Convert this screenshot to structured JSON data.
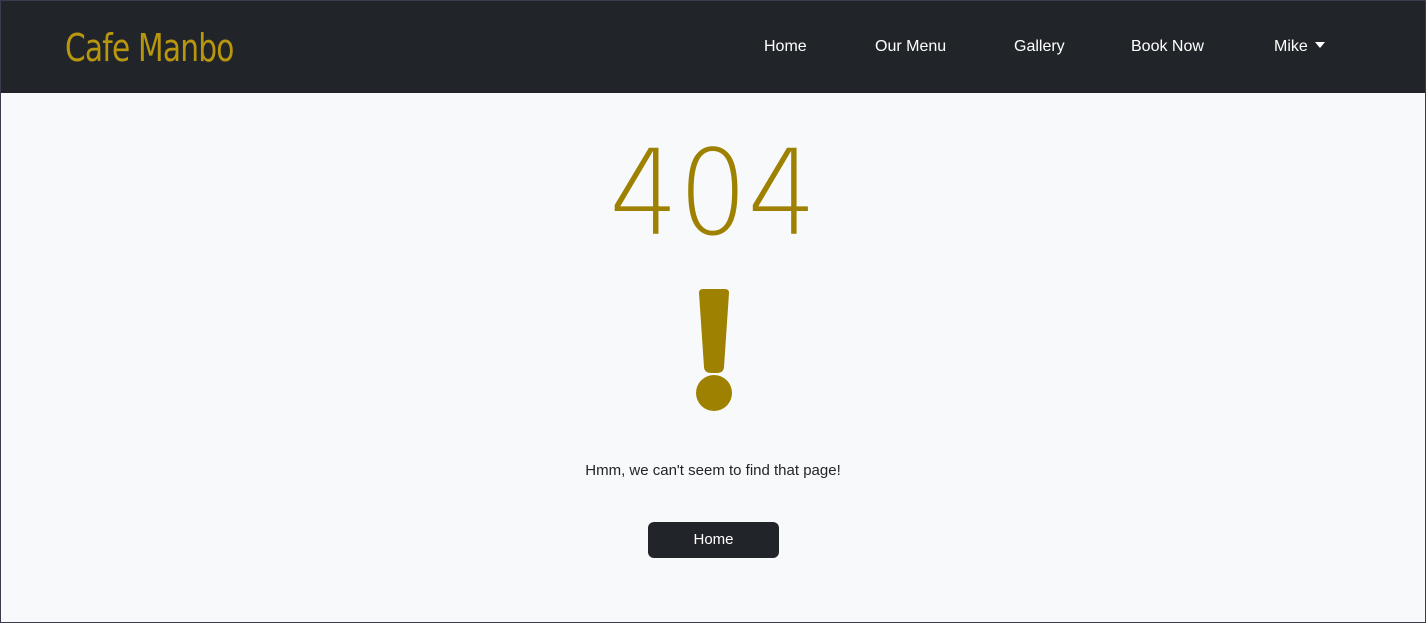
{
  "navbar": {
    "brand": "Cafe Manbo",
    "links": {
      "home": "Home",
      "menu": "Our Menu",
      "gallery": "Gallery",
      "book": "Book Now",
      "user": "Mike"
    }
  },
  "error": {
    "code": "404",
    "icon": "exclamation-icon",
    "message": "Hmm, we can't seem to find that page!",
    "button_label": "Home"
  },
  "colors": {
    "navbar_bg": "#212529",
    "brand": "#b8970f",
    "accent": "#9e8100",
    "page_bg": "#f8f9fa",
    "button_bg": "#212529"
  }
}
